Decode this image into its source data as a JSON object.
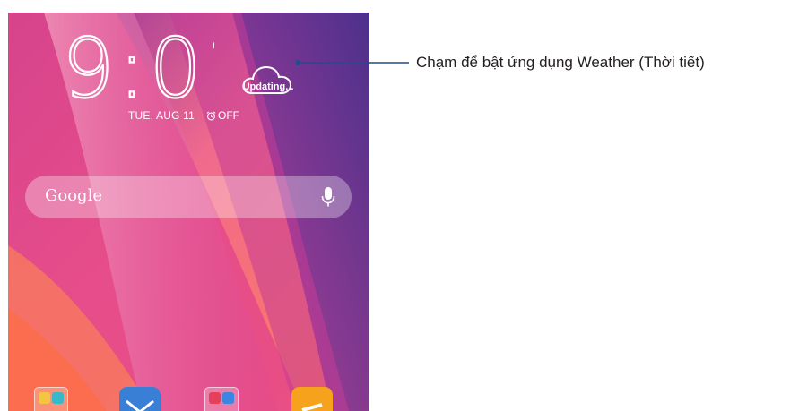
{
  "lockscreen": {
    "time": "9:01",
    "date": "TUE, AUG 11",
    "alarm_label": "OFF",
    "weather_status": "Updating...",
    "search_label": "Google"
  },
  "callout": {
    "text": "Chạm để bật ứng dụng Weather (Thời tiết)",
    "line_color": "#1c4f8f"
  },
  "dock": {
    "items": [
      "folder",
      "mail-icon",
      "folder",
      "app-icon"
    ]
  },
  "colors": {
    "wallpaper_primary": "#e2508f",
    "wallpaper_secondary": "#6c2a9a"
  }
}
